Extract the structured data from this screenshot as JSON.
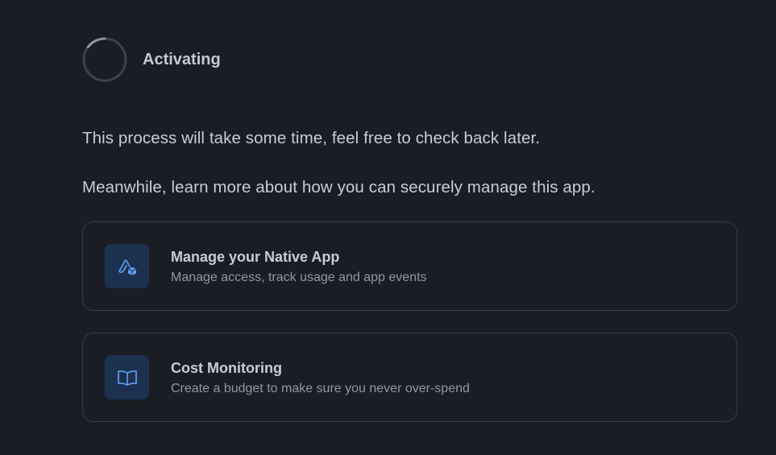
{
  "status": {
    "label": "Activating",
    "icon": "loading-spinner-icon"
  },
  "messages": {
    "line1": "This process will take some time, feel free to check back later.",
    "line2": "Meanwhile, learn more about how you can securely manage this app."
  },
  "cards": [
    {
      "title": "Manage your Native App",
      "subtitle": "Manage access, track usage and app events",
      "icon": "native-app-icon"
    },
    {
      "title": "Cost Monitoring",
      "subtitle": "Create a budget to make sure you never over-spend",
      "icon": "open-book-icon"
    }
  ],
  "colors": {
    "background": "#1a1e24",
    "card_border": "#363c46",
    "icon_box": "#1c3150",
    "icon_accent": "#5d9ef0",
    "text_primary": "#c6cdd8",
    "text_secondary": "#8f97a4"
  }
}
